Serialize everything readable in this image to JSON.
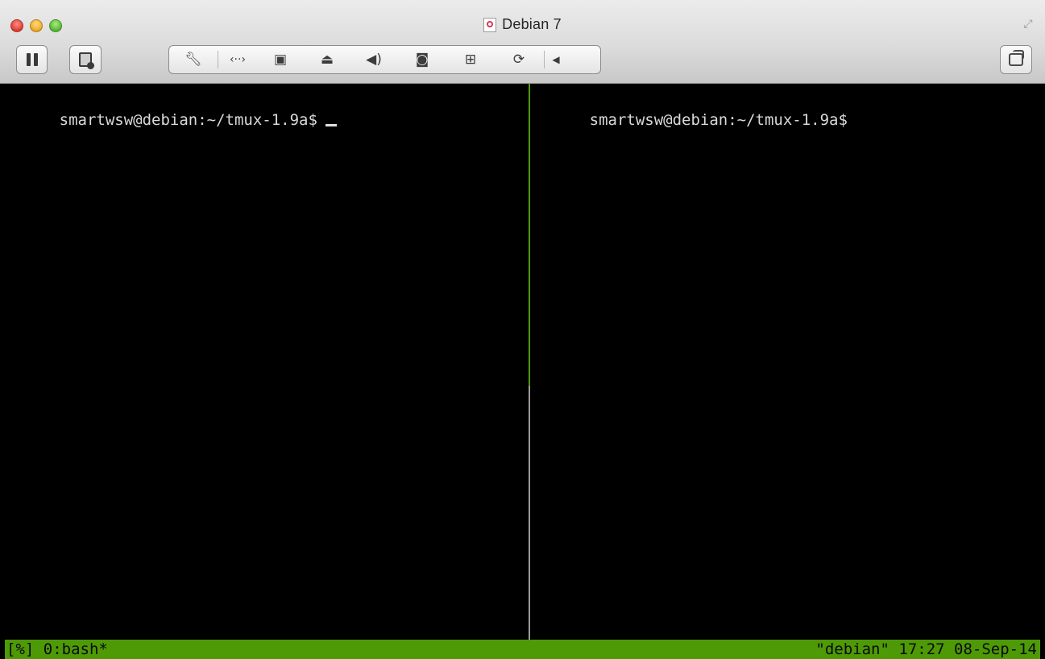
{
  "window": {
    "title": "Debian 7"
  },
  "toolbar": {
    "pause_icon": "pause-icon",
    "snapshot_icon": "snapshot-icon",
    "group_icons": [
      "wrench-icon",
      "network-icon",
      "hard-disk-icon",
      "optical-drive-icon",
      "sound-icon",
      "camera-icon",
      "usb-icon",
      "shared-folders-icon",
      "collapse-arrow-icon"
    ],
    "window_icon": "unity-window-icon"
  },
  "terminal": {
    "left_pane": {
      "prompt": "smartwsw@debian:~/tmux-1.9a$"
    },
    "right_pane": {
      "prompt": "smartwsw@debian:~/tmux-1.9a$"
    },
    "status_bar": {
      "session": "[%]",
      "window": "0:bash*",
      "host": "\"debian\"",
      "time": "17:27",
      "date": "08-Sep-14"
    }
  },
  "colors": {
    "tmux_green": "#4e9a06",
    "terminal_bg": "#000000",
    "terminal_fg": "#d8d8d8"
  }
}
